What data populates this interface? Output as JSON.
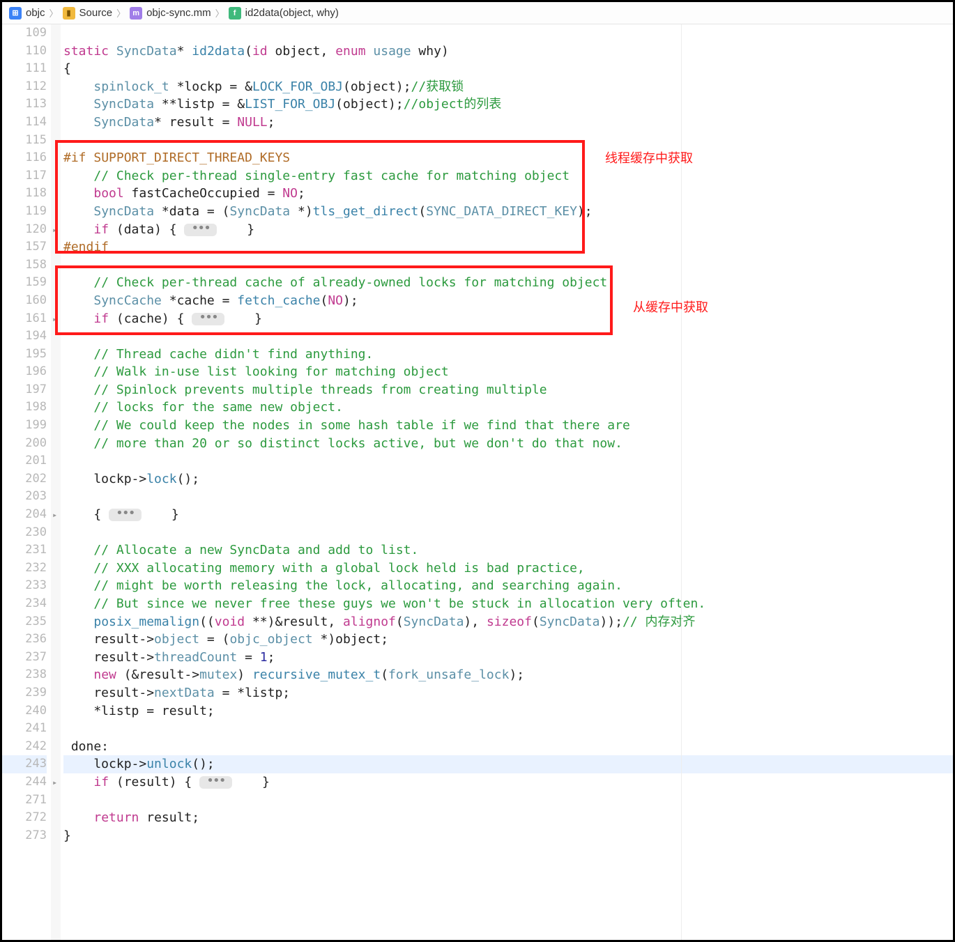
{
  "breadcrumb": {
    "items": [
      {
        "icon": "project-icon",
        "label": "objc"
      },
      {
        "icon": "folder-icon",
        "label": "Source"
      },
      {
        "icon": "file-icon",
        "label": "objc-sync.mm"
      },
      {
        "icon": "func-icon",
        "label": "id2data(object, why)"
      }
    ]
  },
  "annotations": {
    "a1": "线程缓存中获取",
    "a2": "从缓存中获取"
  },
  "fold": {
    "pill": "•••"
  },
  "lines": [
    {
      "n": "109",
      "tokens": []
    },
    {
      "n": "110",
      "tokens": [
        {
          "c": "kw",
          "t": "static"
        },
        {
          "c": "plain",
          "t": " "
        },
        {
          "c": "typ",
          "t": "SyncData"
        },
        {
          "c": "op",
          "t": "* "
        },
        {
          "c": "func",
          "t": "id2data"
        },
        {
          "c": "plain",
          "t": "("
        },
        {
          "c": "kw",
          "t": "id"
        },
        {
          "c": "plain",
          "t": " object, "
        },
        {
          "c": "kw",
          "t": "enum"
        },
        {
          "c": "plain",
          "t": " "
        },
        {
          "c": "typ",
          "t": "usage"
        },
        {
          "c": "plain",
          "t": " why)"
        }
      ]
    },
    {
      "n": "111",
      "tokens": [
        {
          "c": "plain",
          "t": "{"
        }
      ]
    },
    {
      "n": "112",
      "tokens": [
        {
          "c": "plain",
          "t": "    "
        },
        {
          "c": "typ",
          "t": "spinlock_t"
        },
        {
          "c": "plain",
          "t": " *lockp = &"
        },
        {
          "c": "func",
          "t": "LOCK_FOR_OBJ"
        },
        {
          "c": "plain",
          "t": "(object);"
        },
        {
          "c": "com",
          "t": "//获取锁"
        }
      ]
    },
    {
      "n": "113",
      "tokens": [
        {
          "c": "plain",
          "t": "    "
        },
        {
          "c": "typ",
          "t": "SyncData"
        },
        {
          "c": "plain",
          "t": " **listp = &"
        },
        {
          "c": "func",
          "t": "LIST_FOR_OBJ"
        },
        {
          "c": "plain",
          "t": "(object);"
        },
        {
          "c": "com",
          "t": "//object的列表"
        }
      ]
    },
    {
      "n": "114",
      "tokens": [
        {
          "c": "plain",
          "t": "    "
        },
        {
          "c": "typ",
          "t": "SyncData"
        },
        {
          "c": "plain",
          "t": "* result = "
        },
        {
          "c": "kw",
          "t": "NULL"
        },
        {
          "c": "plain",
          "t": ";"
        }
      ]
    },
    {
      "n": "115",
      "tokens": []
    },
    {
      "n": "116",
      "tokens": [
        {
          "c": "pre",
          "t": "#if"
        },
        {
          "c": "plain",
          "t": " "
        },
        {
          "c": "pre",
          "t": "SUPPORT_DIRECT_THREAD_KEYS"
        }
      ]
    },
    {
      "n": "117",
      "tokens": [
        {
          "c": "plain",
          "t": "    "
        },
        {
          "c": "com",
          "t": "// Check per-thread single-entry fast cache for matching object"
        }
      ]
    },
    {
      "n": "118",
      "tokens": [
        {
          "c": "plain",
          "t": "    "
        },
        {
          "c": "kw",
          "t": "bool"
        },
        {
          "c": "plain",
          "t": " fastCacheOccupied = "
        },
        {
          "c": "kw",
          "t": "NO"
        },
        {
          "c": "plain",
          "t": ";"
        }
      ]
    },
    {
      "n": "119",
      "tokens": [
        {
          "c": "plain",
          "t": "    "
        },
        {
          "c": "typ",
          "t": "SyncData"
        },
        {
          "c": "plain",
          "t": " *data = ("
        },
        {
          "c": "typ",
          "t": "SyncData"
        },
        {
          "c": "plain",
          "t": " *)"
        },
        {
          "c": "func",
          "t": "tls_get_direct"
        },
        {
          "c": "plain",
          "t": "("
        },
        {
          "c": "enumc",
          "t": "SYNC_DATA_DIRECT_KEY"
        },
        {
          "c": "plain",
          "t": ");"
        }
      ]
    },
    {
      "n": "120",
      "fold": true,
      "tokens": [
        {
          "c": "plain",
          "t": "    "
        },
        {
          "c": "kw",
          "t": "if"
        },
        {
          "c": "plain",
          "t": " (data) { "
        },
        {
          "c": "pill",
          "t": ""
        },
        {
          "c": "plain",
          "t": "    }"
        }
      ]
    },
    {
      "n": "157",
      "tokens": [
        {
          "c": "pre",
          "t": "#endif"
        }
      ]
    },
    {
      "n": "158",
      "tokens": []
    },
    {
      "n": "159",
      "tokens": [
        {
          "c": "plain",
          "t": "    "
        },
        {
          "c": "com",
          "t": "// Check per-thread cache of already-owned locks for matching object"
        }
      ]
    },
    {
      "n": "160",
      "tokens": [
        {
          "c": "plain",
          "t": "    "
        },
        {
          "c": "typ",
          "t": "SyncCache"
        },
        {
          "c": "plain",
          "t": " *cache = "
        },
        {
          "c": "func",
          "t": "fetch_cache"
        },
        {
          "c": "plain",
          "t": "("
        },
        {
          "c": "kw",
          "t": "NO"
        },
        {
          "c": "plain",
          "t": ");"
        }
      ]
    },
    {
      "n": "161",
      "fold": true,
      "tokens": [
        {
          "c": "plain",
          "t": "    "
        },
        {
          "c": "kw",
          "t": "if"
        },
        {
          "c": "plain",
          "t": " (cache) { "
        },
        {
          "c": "pill",
          "t": ""
        },
        {
          "c": "plain",
          "t": "    }"
        }
      ]
    },
    {
      "n": "194",
      "tokens": []
    },
    {
      "n": "195",
      "tokens": [
        {
          "c": "plain",
          "t": "    "
        },
        {
          "c": "com",
          "t": "// Thread cache didn't find anything."
        }
      ]
    },
    {
      "n": "196",
      "tokens": [
        {
          "c": "plain",
          "t": "    "
        },
        {
          "c": "com",
          "t": "// Walk in-use list looking for matching object"
        }
      ]
    },
    {
      "n": "197",
      "tokens": [
        {
          "c": "plain",
          "t": "    "
        },
        {
          "c": "com",
          "t": "// Spinlock prevents multiple threads from creating multiple "
        }
      ]
    },
    {
      "n": "198",
      "tokens": [
        {
          "c": "plain",
          "t": "    "
        },
        {
          "c": "com",
          "t": "// locks for the same new object."
        }
      ]
    },
    {
      "n": "199",
      "tokens": [
        {
          "c": "plain",
          "t": "    "
        },
        {
          "c": "com",
          "t": "// We could keep the nodes in some hash table if we find that there are"
        }
      ]
    },
    {
      "n": "200",
      "tokens": [
        {
          "c": "plain",
          "t": "    "
        },
        {
          "c": "com",
          "t": "// more than 20 or so distinct locks active, but we don't do that now."
        }
      ]
    },
    {
      "n": "201",
      "tokens": [
        {
          "c": "plain",
          "t": "    "
        }
      ]
    },
    {
      "n": "202",
      "tokens": [
        {
          "c": "plain",
          "t": "    lockp->"
        },
        {
          "c": "func",
          "t": "lock"
        },
        {
          "c": "plain",
          "t": "();"
        }
      ]
    },
    {
      "n": "203",
      "tokens": []
    },
    {
      "n": "204",
      "fold": true,
      "tokens": [
        {
          "c": "plain",
          "t": "    { "
        },
        {
          "c": "pill",
          "t": ""
        },
        {
          "c": "plain",
          "t": "    }"
        }
      ]
    },
    {
      "n": "230",
      "tokens": []
    },
    {
      "n": "231",
      "tokens": [
        {
          "c": "plain",
          "t": "    "
        },
        {
          "c": "com",
          "t": "// Allocate a new SyncData and add to list."
        }
      ]
    },
    {
      "n": "232",
      "tokens": [
        {
          "c": "plain",
          "t": "    "
        },
        {
          "c": "com",
          "t": "// XXX allocating memory with a global lock held is bad practice,"
        }
      ]
    },
    {
      "n": "233",
      "tokens": [
        {
          "c": "plain",
          "t": "    "
        },
        {
          "c": "com",
          "t": "// might be worth releasing the lock, allocating, and searching again."
        }
      ]
    },
    {
      "n": "234",
      "tokens": [
        {
          "c": "plain",
          "t": "    "
        },
        {
          "c": "com",
          "t": "// But since we never free these guys we won't be stuck in allocation very often."
        }
      ]
    },
    {
      "n": "235",
      "tokens": [
        {
          "c": "plain",
          "t": "    "
        },
        {
          "c": "func",
          "t": "posix_memalign"
        },
        {
          "c": "plain",
          "t": "(("
        },
        {
          "c": "kw",
          "t": "void"
        },
        {
          "c": "plain",
          "t": " **)&result, "
        },
        {
          "c": "kw",
          "t": "alignof"
        },
        {
          "c": "plain",
          "t": "("
        },
        {
          "c": "typ",
          "t": "SyncData"
        },
        {
          "c": "plain",
          "t": "), "
        },
        {
          "c": "kw",
          "t": "sizeof"
        },
        {
          "c": "plain",
          "t": "("
        },
        {
          "c": "typ",
          "t": "SyncData"
        },
        {
          "c": "plain",
          "t": "));"
        },
        {
          "c": "com",
          "t": "// 内存对齐"
        }
      ]
    },
    {
      "n": "236",
      "tokens": [
        {
          "c": "plain",
          "t": "    result->"
        },
        {
          "c": "typ",
          "t": "object"
        },
        {
          "c": "plain",
          "t": " = ("
        },
        {
          "c": "typ",
          "t": "objc_object"
        },
        {
          "c": "plain",
          "t": " *)object;"
        }
      ]
    },
    {
      "n": "237",
      "tokens": [
        {
          "c": "plain",
          "t": "    result->"
        },
        {
          "c": "typ",
          "t": "threadCount"
        },
        {
          "c": "plain",
          "t": " = "
        },
        {
          "c": "num",
          "t": "1"
        },
        {
          "c": "plain",
          "t": ";"
        }
      ]
    },
    {
      "n": "238",
      "tokens": [
        {
          "c": "plain",
          "t": "    "
        },
        {
          "c": "kw",
          "t": "new"
        },
        {
          "c": "plain",
          "t": " (&result->"
        },
        {
          "c": "typ",
          "t": "mutex"
        },
        {
          "c": "plain",
          "t": ") "
        },
        {
          "c": "func",
          "t": "recursive_mutex_t"
        },
        {
          "c": "plain",
          "t": "("
        },
        {
          "c": "typ",
          "t": "fork_unsafe_lock"
        },
        {
          "c": "plain",
          "t": ");"
        }
      ]
    },
    {
      "n": "239",
      "tokens": [
        {
          "c": "plain",
          "t": "    result->"
        },
        {
          "c": "typ",
          "t": "nextData"
        },
        {
          "c": "plain",
          "t": " = *listp;"
        }
      ]
    },
    {
      "n": "240",
      "tokens": [
        {
          "c": "plain",
          "t": "    *listp = result;"
        }
      ]
    },
    {
      "n": "241",
      "tokens": [
        {
          "c": "plain",
          "t": "    "
        }
      ]
    },
    {
      "n": "242",
      "tokens": [
        {
          "c": "plain",
          "t": " done:"
        }
      ]
    },
    {
      "n": "243",
      "current": true,
      "tokens": [
        {
          "c": "plain",
          "t": "    lockp->"
        },
        {
          "c": "func",
          "t": "unlock"
        },
        {
          "c": "plain",
          "t": "();"
        }
      ]
    },
    {
      "n": "244",
      "fold": true,
      "tokens": [
        {
          "c": "plain",
          "t": "    "
        },
        {
          "c": "kw",
          "t": "if"
        },
        {
          "c": "plain",
          "t": " (result) { "
        },
        {
          "c": "pill",
          "t": ""
        },
        {
          "c": "plain",
          "t": "    }"
        }
      ]
    },
    {
      "n": "271",
      "tokens": []
    },
    {
      "n": "272",
      "tokens": [
        {
          "c": "plain",
          "t": "    "
        },
        {
          "c": "kw",
          "t": "return"
        },
        {
          "c": "plain",
          "t": " result;"
        }
      ]
    },
    {
      "n": "273",
      "tokens": [
        {
          "c": "plain",
          "t": "}"
        }
      ]
    }
  ]
}
